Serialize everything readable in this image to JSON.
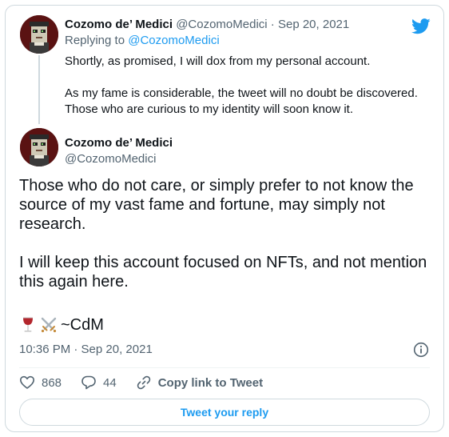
{
  "parent_tweet": {
    "author": {
      "display_name": "Cozomo de’ Medici",
      "handle": "@CozomoMedici"
    },
    "separator": "·",
    "date": "Sep 20, 2021",
    "replying_prefix": "Replying to ",
    "replying_to": "@CozomoMedici",
    "text": "Shortly, as promised, I will dox from my personal account.\n\nAs my fame is considerable, the tweet will no doubt be discovered. Those who are curious to my identity will soon know it."
  },
  "main_tweet": {
    "author": {
      "display_name": "Cozomo de’ Medici",
      "handle": "@CozomoMedici"
    },
    "text": "Those who do not care, or simply prefer to not know the source of my vast fame and fortune, may simply not research.\n\nI will keep this account focused on NFTs, and not mention this again here.",
    "signature": "~CdM",
    "timestamp": "10:36 PM · Sep 20, 2021"
  },
  "actions": {
    "like_count": "868",
    "reply_count": "44",
    "copy_link_label": "Copy link to Tweet"
  },
  "reply_button_label": "Tweet your reply",
  "colors": {
    "brand_blue": "#1d9bf0",
    "secondary_text": "#536471",
    "border": "#cfd9de"
  },
  "icons": [
    "twitter-bird-icon",
    "wine-glass-icon",
    "crossed-swords-icon",
    "info-icon",
    "heart-icon",
    "reply-bubble-icon",
    "link-icon"
  ]
}
